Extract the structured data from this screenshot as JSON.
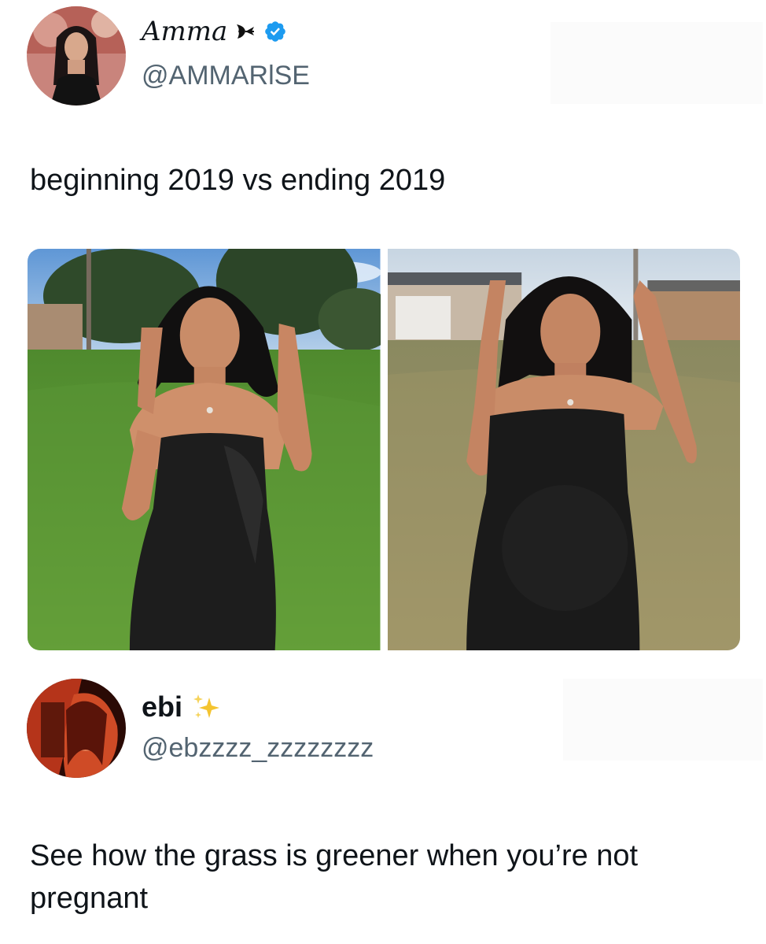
{
  "tweet1": {
    "display_name": "Amma",
    "handle": "@AMMARlSE",
    "text": "beginning 2019 vs ending 2019",
    "avatar_icon": "profile-photo-woman",
    "name_icons": [
      "butterfly-icon",
      "verified-badge-icon"
    ],
    "verified_color": "#1d9bf0",
    "media": [
      {
        "name": "photo-beginning-2019",
        "scene": "woman in black strapless dress, green grass"
      },
      {
        "name": "photo-ending-2019",
        "scene": "pregnant woman in black strapless dress, dry grass"
      }
    ]
  },
  "tweet2": {
    "display_name": "ebi",
    "handle": "@ebzzzz_zzzzzzzz",
    "text": "See how the grass is greener when you’re not pregnant",
    "avatar_icon": "profile-photo-red",
    "name_icons": [
      "sparkles-icon"
    ]
  }
}
